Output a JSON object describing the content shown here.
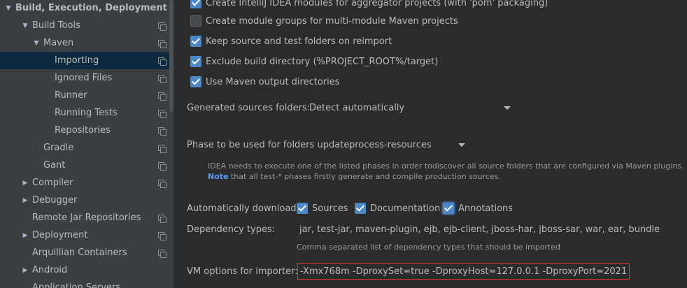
{
  "sidebar": {
    "items": [
      {
        "label": "Build, Execution, Deployment",
        "arrow": "▼",
        "copy": false
      },
      {
        "label": "Build Tools",
        "arrow": "▼",
        "copy": true
      },
      {
        "label": "Maven",
        "arrow": "▼",
        "copy": true
      },
      {
        "label": "Importing",
        "arrow": "",
        "copy": true,
        "selected": true
      },
      {
        "label": "Ignored Files",
        "arrow": "",
        "copy": true
      },
      {
        "label": "Runner",
        "arrow": "",
        "copy": true
      },
      {
        "label": "Running Tests",
        "arrow": "",
        "copy": true
      },
      {
        "label": "Repositories",
        "arrow": "",
        "copy": true
      },
      {
        "label": "Gradle",
        "arrow": "",
        "copy": true
      },
      {
        "label": "Gant",
        "arrow": "",
        "copy": true
      },
      {
        "label": "Compiler",
        "arrow": "▶",
        "copy": true
      },
      {
        "label": "Debugger",
        "arrow": "▶",
        "copy": false
      },
      {
        "label": "Remote Jar Repositories",
        "arrow": "",
        "copy": true
      },
      {
        "label": "Deployment",
        "arrow": "▶",
        "copy": true
      },
      {
        "label": "Arquillian Containers",
        "arrow": "",
        "copy": true
      },
      {
        "label": "Android",
        "arrow": "▶",
        "copy": false
      },
      {
        "label": "Application Servers",
        "arrow": "",
        "copy": false
      }
    ]
  },
  "main": {
    "checkboxes": [
      {
        "label": "Create IntelliJ IDEA modules for aggregator projects (with 'pom' packaging)",
        "checked": true
      },
      {
        "label": "Create module groups for multi-module Maven projects",
        "checked": false
      },
      {
        "label": "Keep source and test folders on reimport",
        "checked": true
      },
      {
        "label": "Exclude build directory (%PROJECT_ROOT%/target)",
        "checked": true
      },
      {
        "label": "Use Maven output directories",
        "checked": true
      }
    ],
    "generated_sources_label": "Generated sources folders:",
    "generated_sources_value": "Detect automatically",
    "phase_label": "Phase to be used for folders update:",
    "phase_value": "process-resources",
    "phase_hint_line1": "IDEA needs to execute one of the listed phases in order todiscover all source folders that are configured via Maven plugins.",
    "phase_hint_note": "Note",
    "phase_hint_line2": " that all test-* phases firstly generate and compile production sources.",
    "auto_download_label": "Automatically download:",
    "auto_download": [
      {
        "label": "Sources",
        "checked": true
      },
      {
        "label": "Documentation",
        "checked": true
      },
      {
        "label": "Annotations",
        "checked": true
      }
    ],
    "dependency_types_label": "Dependency types:",
    "dependency_types_value": "jar, test-jar, maven-plugin, ejb, ejb-client, jboss-har, jboss-sar, war, ear, bundle",
    "dependency_types_hint": "Comma separated list of dependency types that should be imported",
    "vm_options_label": "VM options for importer:",
    "vm_options_value": "-Xmx768m -DproxySet=true -DproxyHost=127.0.0.1 -DproxyPort=2021"
  },
  "colors": {
    "accent": "#4c87c7",
    "selection": "#0d293e",
    "highlight_border": "#e0332f"
  }
}
